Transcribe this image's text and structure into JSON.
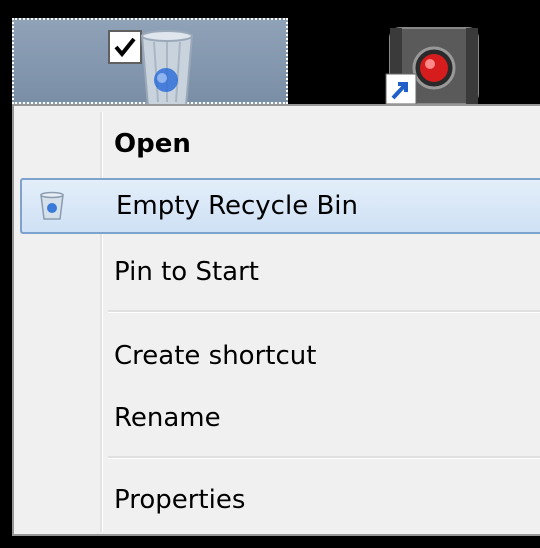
{
  "desktop": {
    "icons": [
      {
        "name": "Recycle Bin",
        "selected": true,
        "checked": true
      },
      {
        "name": "media shortcut",
        "selected": false
      }
    ]
  },
  "context_menu": {
    "items": [
      {
        "label": "Open",
        "bold": true
      },
      {
        "label": "Empty Recycle Bin",
        "highlighted": true,
        "icon": "recycle-bin-icon"
      },
      {
        "label": "Pin to Start"
      },
      {
        "label": "Create shortcut"
      },
      {
        "label": "Rename"
      },
      {
        "label": "Properties"
      }
    ]
  },
  "colors": {
    "menu_bg": "#f0f0f0",
    "highlight_border": "#7da2ce",
    "highlight_fill": "#dbe8f7",
    "desktop_bg": "#000000",
    "selection_fill": "#8fa2b8"
  }
}
